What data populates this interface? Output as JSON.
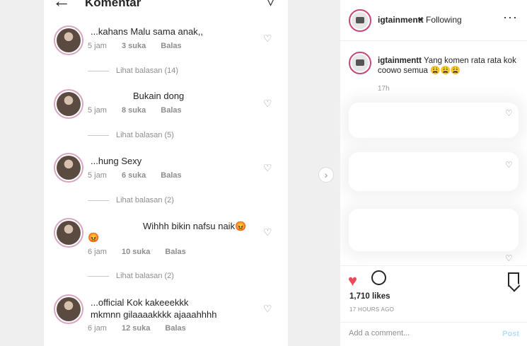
{
  "image": {
    "header": {
      "title": "Komentar"
    },
    "comments": [
      {
        "text": "...kahans Malu sama anak,,",
        "time": "5 jam",
        "likes": "3 suka",
        "reply": "Balas",
        "replies": "Lihat balasan (14)"
      },
      {
        "text": "Bukain dong",
        "time": "5 jam",
        "likes": "8 suka",
        "reply": "Balas",
        "replies": "Lihat balasan (5)"
      },
      {
        "text": "...hung Sexy",
        "time": "5 jam",
        "likes": "6 suka",
        "reply": "Balas",
        "replies": "Lihat balasan (2)"
      },
      {
        "text": "Wihhh bikin nafsu naik😡",
        "text2": "😡",
        "time": "6 jam",
        "likes": "10 suka",
        "reply": "Balas",
        "replies": "Lihat balasan (2)"
      },
      {
        "text": "...official Kok kakeeekkk",
        "text2": "mkmnn gilaaaakkkk ajaaahhhh",
        "time": "6 jam",
        "likes": "12 suka",
        "reply": "Balas"
      }
    ]
  },
  "post": {
    "username": "igtainmentt",
    "dot": "•",
    "follow_status": "Following",
    "more": "···",
    "caption_user": "igtainmentt",
    "caption_text": "Yang komen rata rata kok coowo semua 😩😩😩",
    "caption_time": "17h",
    "likes": "1,710 likes",
    "date": "17 HOURS AGO",
    "comment_placeholder": "Add a comment...",
    "post_label": "Post"
  },
  "icons": {
    "back": "back-arrow-icon",
    "send": "send-icon",
    "heart": "heart-icon",
    "like_filled": "heart-filled-icon",
    "comment": "comment-icon",
    "save": "bookmark-icon",
    "next": "chevron-right-icon",
    "more": "more-icon"
  },
  "colors": {
    "like": "#ed4956",
    "post_button": "#b2dffc",
    "story_ring": "#c7457a"
  }
}
